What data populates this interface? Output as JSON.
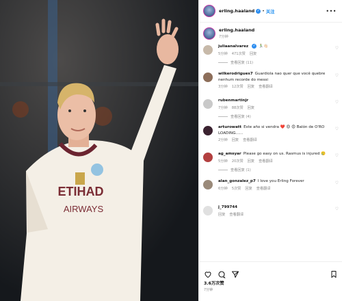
{
  "post": {
    "author": "erling.haaland",
    "follow_label": "关注",
    "owner_time": "7分钟",
    "likes": "3.6万次赞",
    "post_time": "7分钟"
  },
  "comments": [
    {
      "user": "juliaanalvarez",
      "verified": true,
      "text": "🏃‍♂️👋🏻",
      "time": "5分钟",
      "likes": "471次赞",
      "reply": "回复",
      "translate": "",
      "replies": "查看回复 (11)"
    },
    {
      "user": "wilkerodrigues7",
      "verified": false,
      "text": "Guardiola nao quer que você quebre nenhum recorde do messi",
      "time": "3分钟",
      "likes": "12次赞",
      "reply": "回复",
      "translate": "查看翻译",
      "replies": ""
    },
    {
      "user": "rubenmartinjr",
      "verified": false,
      "text": "",
      "time": "7分钟",
      "likes": "88次赞",
      "reply": "回复",
      "translate": "",
      "replies": "查看回复 (4)"
    },
    {
      "user": "arturowatt",
      "verified": false,
      "text": "Este año si vendra ❤️ 😍 😍 Balón de O'RO LOADING......",
      "time": "2分钟",
      "likes": "",
      "reply": "回复",
      "translate": "查看翻译",
      "replies": ""
    },
    {
      "user": "ag_amsyar",
      "verified": false,
      "text": "Please go easy on us. Rasmus is injured 🥲",
      "time": "5分钟",
      "likes": "20次赞",
      "reply": "回复",
      "translate": "查看翻译",
      "replies": "查看回复 (1)"
    },
    {
      "user": "alan_gonzalez_p7",
      "verified": false,
      "text": "I love you Erling Forever",
      "time": "6分钟",
      "likes": "5次赞",
      "reply": "回复",
      "translate": "查看翻译",
      "replies": ""
    },
    {
      "user": "j_799744",
      "verified": false,
      "text": "",
      "time": "",
      "likes": "",
      "reply": "回复",
      "translate": "查看翻译",
      "replies": ""
    }
  ],
  "colors": {
    "accent": "#1a8cf0",
    "verified": "#2e8ef0",
    "shirt": "#f4efe6",
    "shirt_trim": "#6b2430"
  },
  "icons": [
    "more-icon",
    "heart-icon",
    "comment-icon",
    "share-icon",
    "bookmark-icon",
    "verified-icon"
  ]
}
